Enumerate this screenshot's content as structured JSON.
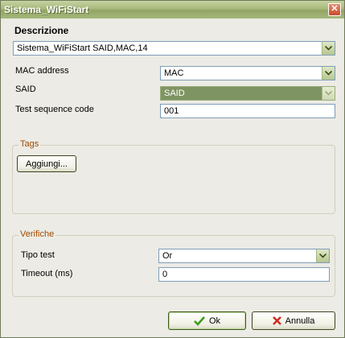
{
  "window": {
    "title": "Sistema_WiFiStart"
  },
  "descrizione": {
    "label": "Descrizione",
    "value": "Sistema_WiFiStart SAID,MAC,14"
  },
  "fields": {
    "mac_label": "MAC address",
    "mac_value": "MAC",
    "said_label": "SAID",
    "said_value": "SAID",
    "tsc_label": "Test sequence code",
    "tsc_value": "001"
  },
  "tags": {
    "title": "Tags",
    "add_label": "Aggiungi..."
  },
  "verifiche": {
    "title": "Verifiche",
    "tipo_label": "Tipo test",
    "tipo_value": "Or",
    "timeout_label": "Timeout (ms)",
    "timeout_value": "0"
  },
  "buttons": {
    "ok": "Ok",
    "cancel": "Annulla"
  },
  "colors": {
    "ok_check": "#3f9b1c",
    "cancel_x": "#d0281e",
    "group_title": "#a04b00"
  }
}
